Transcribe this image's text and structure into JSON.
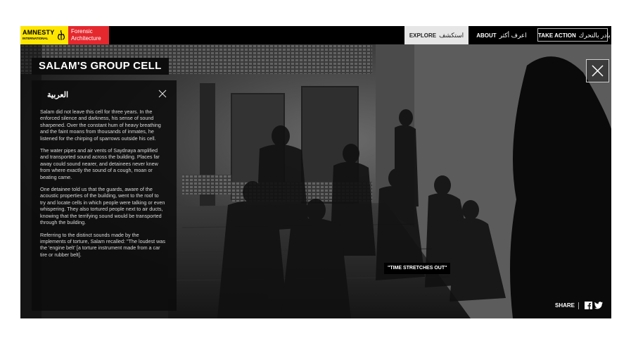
{
  "header": {
    "logo_amnesty_line1": "AMNESTY",
    "logo_amnesty_line2": "INTERNATIONAL",
    "logo_fa_line1": "Forensic",
    "logo_fa_line2": "Architecture",
    "nav": {
      "explore_en": "EXPLORE",
      "explore_ar": "استكشف",
      "about_en": "ABOUT",
      "about_ar": "اعرف أكثر",
      "action_en": "TAKE ACTION",
      "action_ar": "بادر بالتحرك"
    }
  },
  "scene": {
    "title": "SALAM'S GROUP CELL",
    "caption": "\"TIME STRETCHES OUT\""
  },
  "panel": {
    "language": "العربية",
    "paragraphs": [
      "Salam did not leave this cell for three years. In the enforced silence and darkness, his sense of sound sharpened. Over the constant hum of heavy breathing and the faint moans from thousands of inmates, he listened for the chirping of sparrows outside his cell.",
      "The water pipes and air vents of Saydnaya amplified and transported sound across the building. Places far away could sound nearer, and detainees never knew from where exactly the sound of a cough, moan or beating came.",
      "One detainee told us that the guards, aware of the acoustic properties of the building, went to the roof to try and locate cells in which people were talking or even whispering. They also tortured people next to air ducts, knowing that the terrifying sound would be transported through the building.",
      "Referring to the distinct sounds made by the implements of torture, Salam recalled: \"The loudest was the 'engine belt' [a torture instrument made from a car tire or rubber belt]."
    ]
  },
  "share": {
    "label": "SHARE"
  },
  "colors": {
    "amnesty_yellow": "#ffe600",
    "fa_red": "#e4282e",
    "bar": "#000000"
  }
}
